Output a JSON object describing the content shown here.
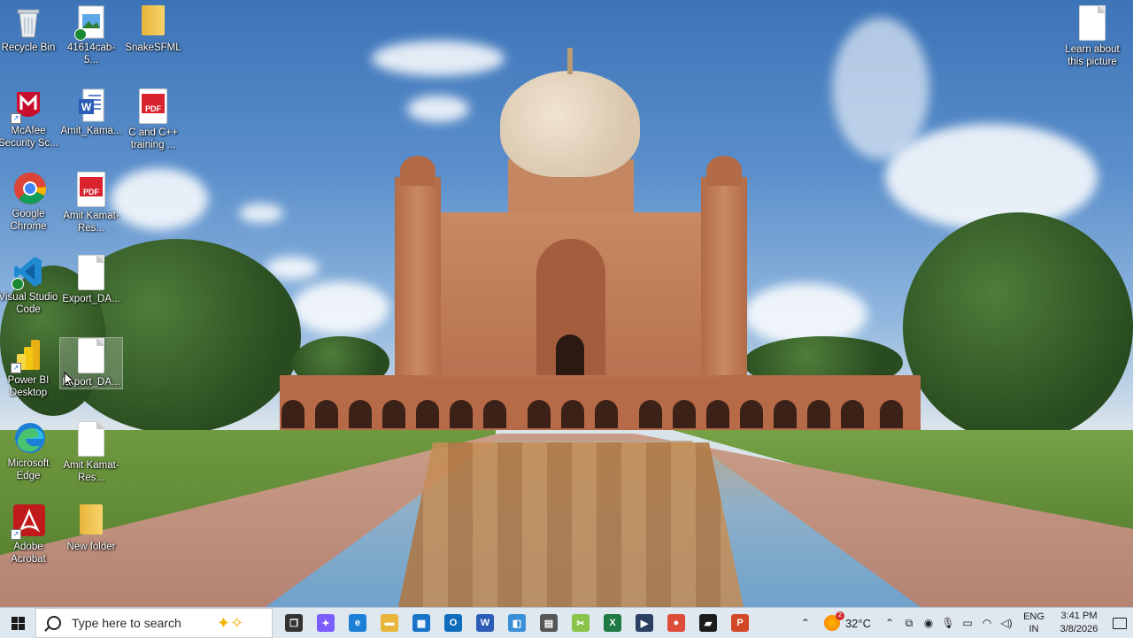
{
  "desktop": {
    "icons": [
      {
        "label": "Recycle Bin",
        "icon": "recycle-bin-icon"
      },
      {
        "label": "41614cab-5...",
        "icon": "image-file-icon"
      },
      {
        "label": "SnakeSFML",
        "icon": "folder-icon"
      },
      {
        "label": "Learn about this picture",
        "icon": "document-icon"
      },
      {
        "label": "McAfee Security Sc...",
        "icon": "mcafee-icon"
      },
      {
        "label": "Amit_Kama...",
        "icon": "word-icon"
      },
      {
        "label": "C and C++ training ...",
        "icon": "pdf-icon"
      },
      {
        "label": "Google Chrome",
        "icon": "chrome-icon"
      },
      {
        "label": "Amit Kamat-Res...",
        "icon": "pdf-icon"
      },
      {
        "label": "Visual Studio Code",
        "icon": "vscode-icon"
      },
      {
        "label": "Export_DA...",
        "icon": "document-icon"
      },
      {
        "label": "Power BI Desktop",
        "icon": "powerbi-icon"
      },
      {
        "label": "Export_DA...",
        "icon": "document-icon"
      },
      {
        "label": "Microsoft Edge",
        "icon": "edge-icon"
      },
      {
        "label": "Amit Kamat-Res...",
        "icon": "document-icon"
      },
      {
        "label": "Adobe Acrobat",
        "icon": "acrobat-icon"
      },
      {
        "label": "New folder",
        "icon": "folder-icon"
      }
    ],
    "pdf_badge": "PDF",
    "word_badge": "W"
  },
  "taskbar": {
    "search_placeholder": "Type here to search",
    "pinned": [
      {
        "name": "task-view",
        "glyph": "❐",
        "color": "#333333"
      },
      {
        "name": "copilot",
        "glyph": "✦",
        "color": "#7b5cff"
      },
      {
        "name": "edge",
        "glyph": "e",
        "color": "#1b7fd6"
      },
      {
        "name": "file-explorer",
        "glyph": "▬",
        "color": "#e8b53a"
      },
      {
        "name": "microsoft-store",
        "glyph": "▦",
        "color": "#1a73c9"
      },
      {
        "name": "outlook",
        "glyph": "O",
        "color": "#0f6cbd"
      },
      {
        "name": "word",
        "glyph": "W",
        "color": "#2b5cb6"
      },
      {
        "name": "remote-desktop",
        "glyph": "◧",
        "color": "#3a8fd6"
      },
      {
        "name": "calculator",
        "glyph": "▤",
        "color": "#555555"
      },
      {
        "name": "snipping-tool",
        "glyph": "✂",
        "color": "#8bc34a"
      },
      {
        "name": "excel",
        "glyph": "X",
        "color": "#1d7a43"
      },
      {
        "name": "visual-studio",
        "glyph": "▶",
        "color": "#2b3f63"
      },
      {
        "name": "chrome",
        "glyph": "●",
        "color": "#dd4b39"
      },
      {
        "name": "sticky-notes",
        "glyph": "▰",
        "color": "#1c1c1c"
      },
      {
        "name": "powerpoint",
        "glyph": "P",
        "color": "#d24726"
      }
    ],
    "weather": {
      "temperature": "32°C",
      "badge": "2"
    },
    "language": {
      "line1": "ENG",
      "line2": "IN"
    },
    "clock": {
      "time": "3:41 PM",
      "date": "3/8/2026"
    }
  }
}
